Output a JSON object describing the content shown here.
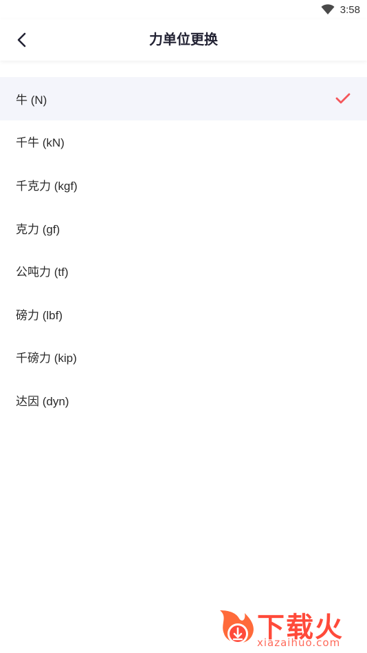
{
  "status_bar": {
    "time": "3:58",
    "wifi_icon": "wifi-icon"
  },
  "header": {
    "title": "力单位更换",
    "back_icon": "back-arrow-icon"
  },
  "units": [
    {
      "label": "牛 (N)",
      "selected": true
    },
    {
      "label": "千牛 (kN)",
      "selected": false
    },
    {
      "label": "千克力 (kgf)",
      "selected": false
    },
    {
      "label": "克力 (gf)",
      "selected": false
    },
    {
      "label": "公吨力 (tf)",
      "selected": false
    },
    {
      "label": "磅力 (lbf)",
      "selected": false
    },
    {
      "label": "千磅力 (kip)",
      "selected": false
    },
    {
      "label": "达因 (dyn)",
      "selected": false
    }
  ],
  "colors": {
    "accent": "#f4565a",
    "selected_bg": "#f4f5fb",
    "title": "#222233"
  },
  "watermark": {
    "brand": "下载火",
    "url": "xiazaihuo.com"
  }
}
